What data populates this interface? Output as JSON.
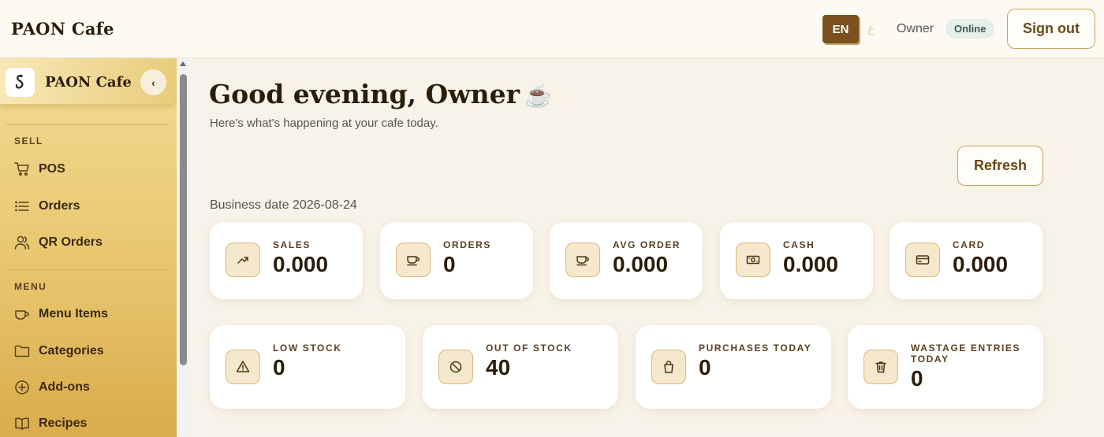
{
  "topbar": {
    "brand": "PAON Cafe",
    "lang_en": "EN",
    "lang_ar": "ع",
    "role": "Owner",
    "status": "Online",
    "sign_out": "Sign out"
  },
  "sidebar": {
    "title": "PAON Cafe",
    "collapse": "‹",
    "sections": [
      {
        "label": "SELL",
        "items": [
          {
            "label": "POS",
            "icon": "cart-icon"
          },
          {
            "label": "Orders",
            "icon": "list-icon"
          },
          {
            "label": "QR Orders",
            "icon": "users-icon"
          }
        ]
      },
      {
        "label": "MENU",
        "items": [
          {
            "label": "Menu Items",
            "icon": "cup-icon"
          },
          {
            "label": "Categories",
            "icon": "folder-icon"
          },
          {
            "label": "Add-ons",
            "icon": "plus-circle-icon"
          },
          {
            "label": "Recipes",
            "icon": "book-icon"
          }
        ]
      }
    ]
  },
  "main": {
    "greeting": "Good evening, Owner",
    "greeting_emoji": "☕",
    "subtitle": "Here's what's happening at your cafe today.",
    "refresh": "Refresh",
    "business_date": "Business date 2026-08-24",
    "stats_row1": [
      {
        "label": "SALES",
        "value": "0.000",
        "icon": "trend-up-icon"
      },
      {
        "label": "ORDERS",
        "value": "0",
        "icon": "coffee-cup-icon"
      },
      {
        "label": "AVG ORDER",
        "value": "0.000",
        "icon": "coffee-cup-icon"
      },
      {
        "label": "CASH",
        "value": "0.000",
        "icon": "cash-icon"
      },
      {
        "label": "CARD",
        "value": "0.000",
        "icon": "credit-card-icon"
      }
    ],
    "stats_row2": [
      {
        "label": "LOW STOCK",
        "value": "0",
        "icon": "warning-icon"
      },
      {
        "label": "OUT OF STOCK",
        "value": "40",
        "icon": "ban-icon"
      },
      {
        "label": "PURCHASES TODAY",
        "value": "0",
        "icon": "bag-icon"
      },
      {
        "label": "WASTAGE ENTRIES TODAY",
        "value": "0",
        "icon": "trash-icon"
      }
    ]
  }
}
